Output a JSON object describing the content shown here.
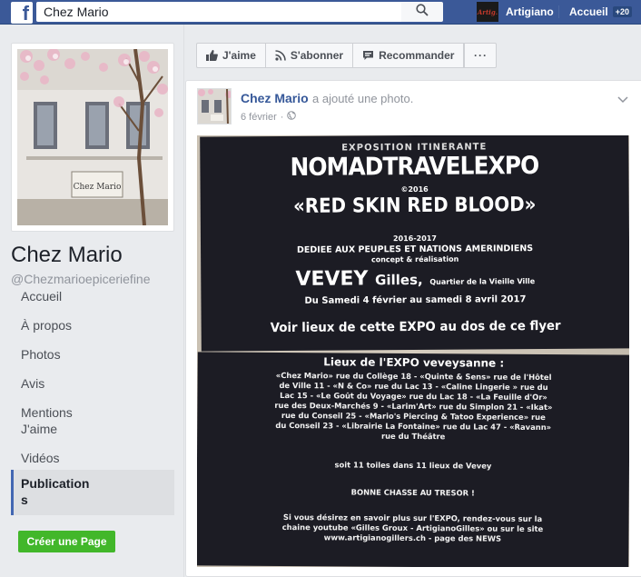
{
  "topbar": {
    "logo": "f",
    "search_value": "Chez Mario",
    "search_icon": "search-icon",
    "profile_name": "Artigiano",
    "home_label": "Accueil",
    "home_badge": "+20"
  },
  "page": {
    "name": "Chez Mario",
    "handle": "@Chezmarioepiceriefine",
    "cover_sign": "Chez Mario"
  },
  "nav": {
    "items": [
      {
        "label": "Accueil"
      },
      {
        "label": "À propos"
      },
      {
        "label": "Photos"
      },
      {
        "label": "Avis"
      },
      {
        "label": "Mentions J'aime"
      },
      {
        "label": "Vidéos"
      },
      {
        "label": "Publications"
      }
    ],
    "create_page": "Créer une Page"
  },
  "actions": {
    "like": "J'aime",
    "follow": "S'abonner",
    "recommend": "Recommander",
    "more": "···"
  },
  "post": {
    "author": "Chez Mario",
    "action": "a ajouté une photo.",
    "date": "6 février",
    "separator": "·"
  },
  "flyer": {
    "top": {
      "l1": "EXPOSITION ITINERANTE",
      "l2": "NOMADTRAVELEXPO",
      "l3": "©2016",
      "l4": "«RED SKIN RED BLOOD»",
      "l5": "2016-2017",
      "l6": "DEDIEE AUX PEUPLES ET NATIONS AMERINDIENS",
      "l7": "concept & réalisation",
      "l8a": "VEVEY",
      "l8b": "Gilles,",
      "l8c": "Quartier de la Vieille Ville",
      "l9": "Du Samedi 4 février au samedi 8 avril 2017",
      "l10": "Voir lieux de cette EXPO au dos de ce flyer"
    },
    "bottom": {
      "title": "Lieux de l'EXPO veveysanne :",
      "body": [
        "«Chez Mario» rue du Collège 18 - «Quinte & Sens» rue de l'Hôtel",
        "de Ville 11 - «N & Co» rue du Lac 13 - «Caline Lingerie » rue du",
        "Lac 15 - «Le Goût du Voyage» rue du Lac 18 - «La Feuille d'Or»",
        "rue des Deux-Marchés 9 - «Larim'Art» rue du Simplon 21 - «Ikat»",
        "rue du Conseil 25 - «Mario's Piercing & Tatoo Experience» rue",
        "du Conseil 23 - «Librairie La Fontaine» rue du Lac 47 - «Ravann»",
        "rue du Théâtre"
      ],
      "count": "soit 11 toiles dans 11 lieux de Vevey",
      "wish": "BONNE CHASSE AU TRESOR !",
      "info": [
        "Si vous désirez en savoir plus sur l'EXPO, rendez-vous sur la",
        "chaine youtube «Gilles Groux - ArtigianoGilles» ou sur le site",
        "www.artigianogillers.ch - page des NEWS"
      ]
    }
  }
}
